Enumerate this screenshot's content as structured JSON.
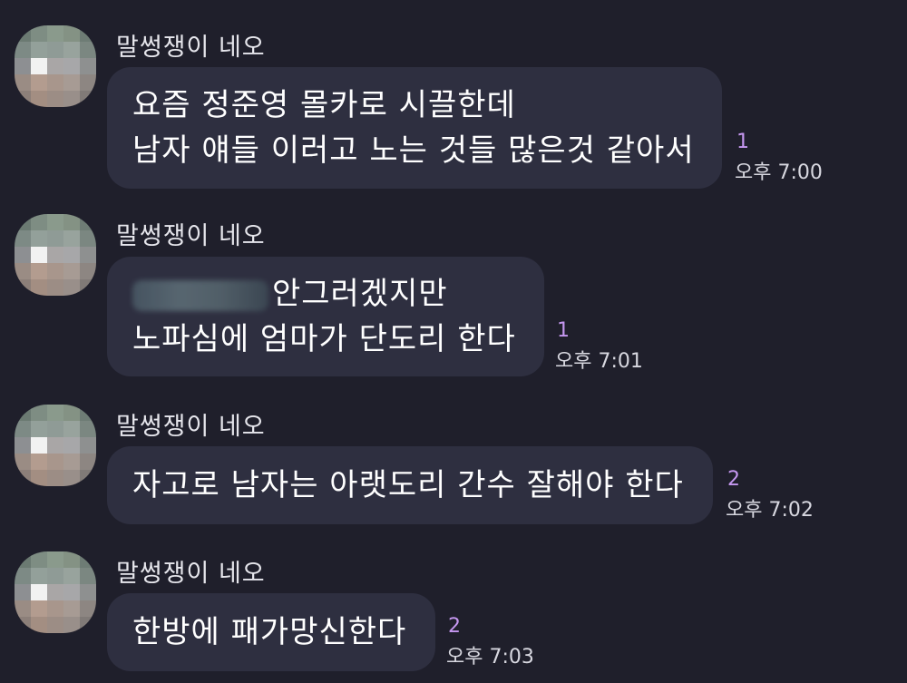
{
  "messages": [
    {
      "sender": "말썽쟁이 네오",
      "lines": [
        "요즘 정준영 몰카로 시끌한데",
        "남자 얘들 이러고 노는 것들 많은것 같아서"
      ],
      "unread": "1",
      "time": "오후 7:00"
    },
    {
      "sender": "말썽쟁이 네오",
      "lines": [
        "안그러겠지만",
        "노파심에 엄마가 단도리 한다"
      ],
      "unread": "1",
      "time": "오후 7:01"
    },
    {
      "sender": "말썽쟁이 네오",
      "lines": [
        "자고로 남자는 아랫도리 간수 잘해야 한다"
      ],
      "unread": "2",
      "time": "오후 7:02"
    },
    {
      "sender": "말썽쟁이 네오",
      "lines": [
        "한방에 패가망신한다"
      ],
      "unread": "2",
      "time": "오후 7:03"
    }
  ]
}
